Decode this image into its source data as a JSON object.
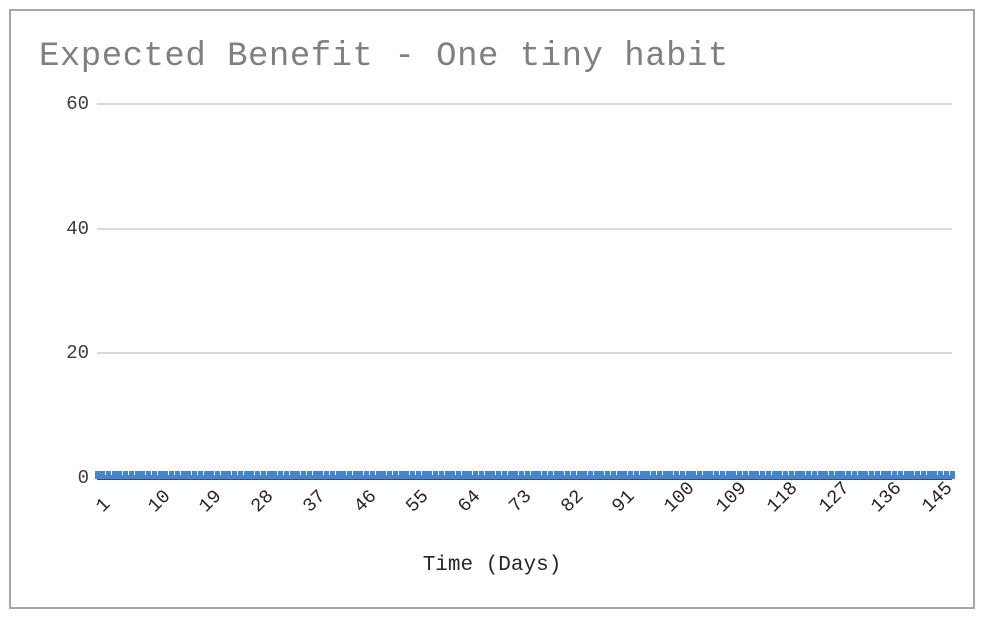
{
  "chart_data": {
    "type": "line",
    "title": "Expected Benefit - One tiny habit",
    "subtitle": "",
    "xlabel": "Time (Days)",
    "ylabel": "",
    "xlim": [
      1,
      150
    ],
    "ylim": [
      0,
      60
    ],
    "grid": true,
    "legend": false,
    "legend_position": "none",
    "y_ticks": [
      60,
      40,
      20,
      0
    ],
    "x_ticks": [
      1,
      10,
      19,
      28,
      37,
      46,
      55,
      64,
      73,
      82,
      91,
      100,
      109,
      118,
      127,
      136,
      145
    ],
    "x_tick_rotation_deg": -45,
    "series": [
      {
        "name": "Expected Benefit",
        "color": "#4285d6",
        "marker": "square",
        "x": [
          1,
          2,
          3,
          4,
          5,
          6,
          7,
          8,
          9,
          10,
          11,
          12,
          13,
          14,
          15,
          16,
          17,
          18,
          19,
          20,
          21,
          22,
          23,
          24,
          25,
          26,
          27,
          28,
          29,
          30,
          31,
          32,
          33,
          34,
          35,
          36,
          37,
          38,
          39,
          40,
          41,
          42,
          43,
          44,
          45,
          46,
          47,
          48,
          49,
          50,
          51,
          52,
          53,
          54,
          55,
          56,
          57,
          58,
          59,
          60,
          61,
          62,
          63,
          64,
          65,
          66,
          67,
          68,
          69,
          70,
          71,
          72,
          73,
          74,
          75,
          76,
          77,
          78,
          79,
          80,
          81,
          82,
          83,
          84,
          85,
          86,
          87,
          88,
          89,
          90,
          91,
          92,
          93,
          94,
          95,
          96,
          97,
          98,
          99,
          100,
          101,
          102,
          103,
          104,
          105,
          106,
          107,
          108,
          109,
          110,
          111,
          112,
          113,
          114,
          115,
          116,
          117,
          118,
          119,
          120,
          121,
          122,
          123,
          124,
          125,
          126,
          127,
          128,
          129,
          130,
          131,
          132,
          133,
          134,
          135,
          136,
          137,
          138,
          139,
          140,
          141,
          142,
          143,
          144,
          145,
          146,
          147,
          148,
          149,
          150
        ],
        "values": [
          0.1,
          0.1,
          0.1,
          0.1,
          0.1,
          0.1,
          0.1,
          0.1,
          0.1,
          0.1,
          0.1,
          0.1,
          0.1,
          0.1,
          0.1,
          0.1,
          0.1,
          0.1,
          0.1,
          0.1,
          0.1,
          0.1,
          0.1,
          0.1,
          0.1,
          0.1,
          0.1,
          0.1,
          0.1,
          0.1,
          0.1,
          0.1,
          0.1,
          0.1,
          0.1,
          0.1,
          0.1,
          0.1,
          0.1,
          0.1,
          0.1,
          0.1,
          0.1,
          0.1,
          0.1,
          0.1,
          0.1,
          0.1,
          0.1,
          0.1,
          0.1,
          0.1,
          0.1,
          0.1,
          0.1,
          0.1,
          0.1,
          0.1,
          0.1,
          0.1,
          0.1,
          0.1,
          0.1,
          0.1,
          0.1,
          0.1,
          0.1,
          0.1,
          0.1,
          0.1,
          0.1,
          0.1,
          0.1,
          0.1,
          0.1,
          0.1,
          0.1,
          0.1,
          0.1,
          0.1,
          0.1,
          0.1,
          0.1,
          0.1,
          0.1,
          0.1,
          0.1,
          0.1,
          0.1,
          0.1,
          0.1,
          0.1,
          0.1,
          0.1,
          0.1,
          0.1,
          0.1,
          0.1,
          0.1,
          0.1,
          0.1,
          0.1,
          0.1,
          0.1,
          0.1,
          0.1,
          0.1,
          0.1,
          0.1,
          0.1,
          0.1,
          0.1,
          0.1,
          0.1,
          0.1,
          0.1,
          0.1,
          0.1,
          0.1,
          0.1,
          0.1,
          0.1,
          0.1,
          0.1,
          0.1,
          0.1,
          0.1,
          0.1,
          0.1,
          0.1,
          0.1,
          0.1,
          0.1,
          0.1,
          0.1,
          0.1,
          0.1,
          0.1,
          0.1,
          0.1,
          0.1,
          0.1,
          0.1,
          0.1,
          0.1,
          0.1,
          0.1,
          0.1,
          0.1,
          0.1
        ]
      }
    ]
  },
  "colors": {
    "series": "#4285d6",
    "gridline": "#d9d9d9",
    "axis": "#4a4a4a",
    "frame": "#a6a6a6",
    "title_text": "#808080",
    "tick_text": "#262626"
  }
}
